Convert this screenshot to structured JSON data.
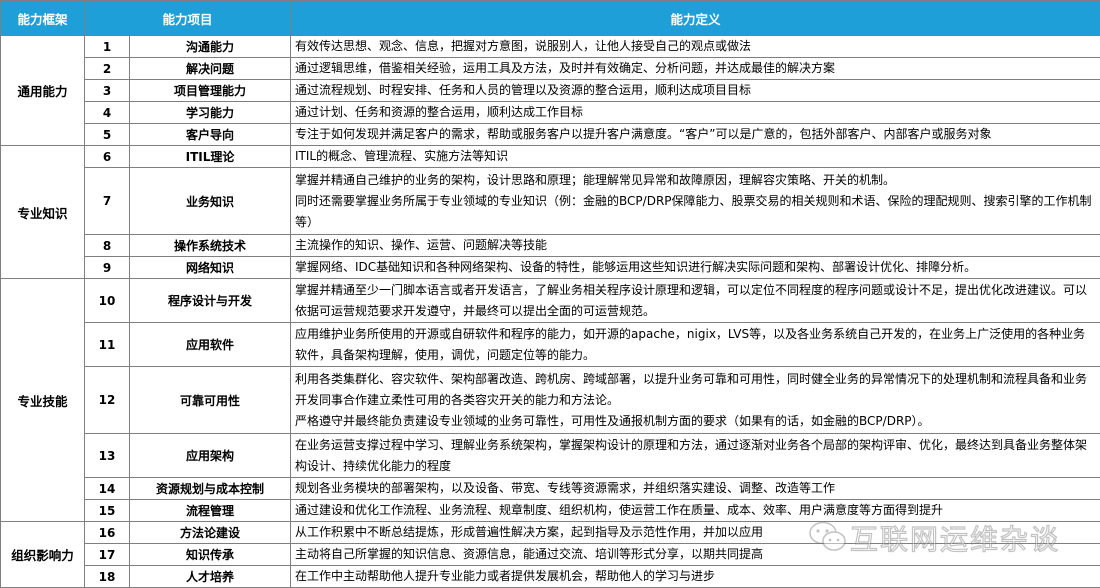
{
  "header": {
    "framework": "能力框架",
    "item": "能力项目",
    "definition": "能力定义"
  },
  "groups": [
    {
      "name": "通用能力",
      "rows": [
        {
          "num": "1",
          "item": "沟通能力",
          "def": [
            "有效传达思想、观念、信息，把握对方意图，说服别人，让他人接受自己的观点或做法"
          ]
        },
        {
          "num": "2",
          "item": "解决问题",
          "def": [
            "通过逻辑思维，借鉴相关经验，运用工具及方法，及时并有效确定、分析问题，并达成最佳的解决方案"
          ]
        },
        {
          "num": "3",
          "item": "项目管理能力",
          "def": [
            "通过流程规划、时程安排、任务和人员的管理以及资源的整合运用，顺利达成项目目标"
          ]
        },
        {
          "num": "4",
          "item": "学习能力",
          "def": [
            "通过计划、任务和资源的整合运用，顺利达成工作目标"
          ]
        },
        {
          "num": "5",
          "item": "客户导向",
          "def": [
            "专注于如何发现并满足客户的需求，帮助或服务客户以提升客户满意度。“客户”可以是广意的，包括外部客户、内部客户或服务对象"
          ]
        }
      ]
    },
    {
      "name": "专业知识",
      "rows": [
        {
          "num": "6",
          "item": "ITIL理论",
          "def": [
            "ITIL的概念、管理流程、实施方法等知识"
          ]
        },
        {
          "num": "7",
          "item": "业务知识",
          "def": [
            "掌握并精通自己维护的业务的架构，设计思路和原理；能理解常见异常和故障原因，理解容灾策略、开关的机制。",
            "同时还需要掌握业务所属于专业领域的专业知识（例：金融的BCP/DRP保障能力、股票交易的相关规则和术语、保险的理配规则、搜索引擎的工作机制等）"
          ]
        },
        {
          "num": "8",
          "item": "操作系统技术",
          "def": [
            "主流操作的知识、操作、运营、问题解决等技能"
          ]
        },
        {
          "num": "9",
          "item": "网络知识",
          "def": [
            "掌握网络、IDC基础知识和各种网络架构、设备的特性，能够运用这些知识进行解决实际问题和架构、部署设计优化、排障分析。"
          ]
        }
      ]
    },
    {
      "name": "专业技能",
      "rows": [
        {
          "num": "10",
          "item": "程序设计与开发",
          "def": [
            "掌握并精通至少一门脚本语言或者开发语言，了解业务相关程序设计原理和逻辑，可以定位不同程度的程序问题或设计不足，提出优化改进建议。可以依据可运营规范要求开发遵守，并最终可以提出全面的可运营规范。"
          ]
        },
        {
          "num": "11",
          "item": "应用软件",
          "def": [
            "应用维护业务所使用的开源或自研软件和程序的能力，如开源的apache，nigix，LVS等，以及各业务系统自己开发的，在业务上广泛使用的各种业务软件，具备架构理解，使用，调优，问题定位等的能力。"
          ]
        },
        {
          "num": "12",
          "item": "可靠可用性",
          "def": [
            "利用各类集群化、容灾软件、架构部署改造、跨机房、跨域部署，以提升业务可靠和可用性，同时健全业务的异常情况下的处理机制和流程具备和业务开发同事合作建立柔性可用的各类容灾开关的能力和方法论。",
            "严格遵守并最终能负责建设专业领域的业务可靠性，可用性及通报机制方面的要求（如果有的话，如金融的BCP/DRP）。"
          ]
        },
        {
          "num": "13",
          "item": "应用架构",
          "def": [
            "在业务运营支撑过程中学习、理解业务系统架构，掌握架构设计的原理和方法，通过逐渐对业务各个局部的架构评审、优化，最终达到具备业务整体架构设计、持续优化能力的程度"
          ]
        },
        {
          "num": "14",
          "item": "资源规划与成本控制",
          "def": [
            "规划各业务模块的部署架构，以及设备、带宽、专线等资源需求，并组织落实建设、调整、改造等工作"
          ]
        },
        {
          "num": "15",
          "item": "流程管理",
          "def": [
            "通过建设和优化工作流程、业务流程、规章制度、组织机构，使运营工作在质量、成本、效率、用户满意度等方面得到提升"
          ]
        }
      ]
    },
    {
      "name": "组织影响力",
      "rows": [
        {
          "num": "16",
          "item": "方法论建设",
          "def": [
            "从工作积累中不断总结提炼，形成普遍性解决方案，起到指导及示范性作用，并加以应用"
          ]
        },
        {
          "num": "17",
          "item": "知识传承",
          "def": [
            "主动将自己所掌握的知识信息、资源信息，能通过交流、培训等形式分享，以期共同提高"
          ]
        },
        {
          "num": "18",
          "item": "人才培养",
          "def": [
            "在工作中主动帮助他人提升专业能力或者提供发展机会，帮助他人的学习与进步"
          ]
        }
      ]
    }
  ],
  "watermark": {
    "text": "互联网运维杂谈",
    "icon": "wechat-icon"
  },
  "colors": {
    "header_bg": "#1e9fd8",
    "header_text": "#ffffff",
    "border": "#7f7f7f"
  }
}
